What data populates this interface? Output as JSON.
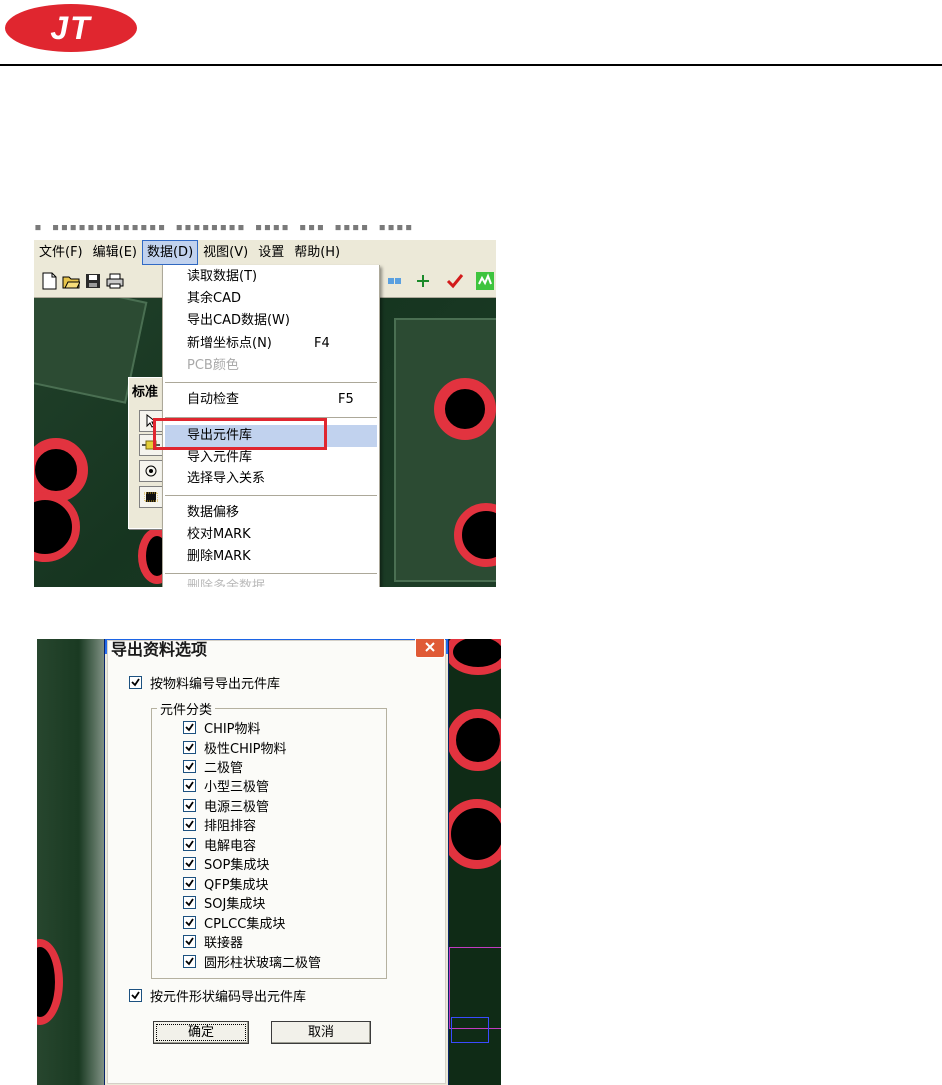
{
  "brand": {
    "logo_text": "JT",
    "logo_color": "#e0262f"
  },
  "screenshot1": {
    "title_text": "▪ ▪▪▪▪▪▪▪▪▪▪▪▪▪  ▪▪▪▪▪▪▪▪  ▪▪▪▪  ▪▪▪  ▪▪▪▪  ▪▪▪▪",
    "menubar": [
      {
        "label": "文件(F)"
      },
      {
        "label": "编辑(E)"
      },
      {
        "label": "数据(D)"
      },
      {
        "label": "视图(V)"
      },
      {
        "label": "设置"
      },
      {
        "label": "帮助(H)"
      }
    ],
    "floating_toolbar_title": "标准",
    "dropdown": {
      "read_data": "读取数据(T)",
      "other_cad": "其余CAD",
      "export_cad": "导出CAD数据(W)",
      "add_coord": "新增坐标点(N)",
      "add_coord_shortcut": "F4",
      "pcb_color": "PCB颜色",
      "auto_check": "自动检查",
      "auto_check_shortcut": "F5",
      "export_lib": "导出元件库",
      "import_lib": "导入元件库",
      "select_import": "选择导入关系",
      "data_offset": "数据偏移",
      "check_mark": "校对MARK",
      "delete_mark": "删除MARK",
      "cut_off_item": "删除多余数据"
    },
    "highlight_color": "#e0262f"
  },
  "screenshot2": {
    "dialog_title": "导出资料选项",
    "export_by_material": {
      "label": "按物料编号导出元件库",
      "checked": true
    },
    "group_label": "元件分类",
    "categories": [
      {
        "label": "CHIP物料",
        "checked": true
      },
      {
        "label": "极性CHIP物料",
        "checked": true
      },
      {
        "label": "二极管",
        "checked": true
      },
      {
        "label": "小型三极管",
        "checked": true
      },
      {
        "label": "电源三极管",
        "checked": true
      },
      {
        "label": "排阻排容",
        "checked": true
      },
      {
        "label": "电解电容",
        "checked": true
      },
      {
        "label": "SOP集成块",
        "checked": true
      },
      {
        "label": "QFP集成块",
        "checked": true
      },
      {
        "label": "SOJ集成块",
        "checked": true
      },
      {
        "label": "CPLCC集成块",
        "checked": true
      },
      {
        "label": "联接器",
        "checked": true
      },
      {
        "label": "圆形柱状玻璃二极管",
        "checked": true
      }
    ],
    "export_by_shape": {
      "label": "按元件形状编码导出元件库",
      "checked": true
    },
    "ok_label": "确定",
    "cancel_label": "取消"
  }
}
